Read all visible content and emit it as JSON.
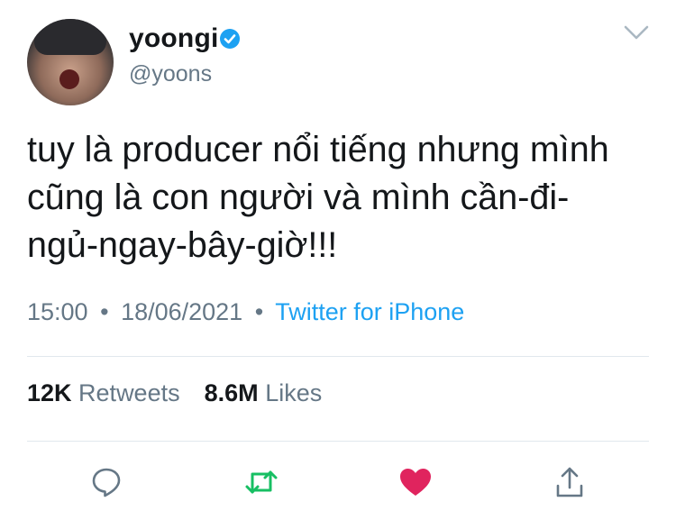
{
  "user": {
    "name": "yoongi",
    "handle": "@yoons"
  },
  "tweet": {
    "text_line1": "tuy là producer nổi tiếng nhưng mình",
    "text_line2": "cũng là con người và mình cần-đi-",
    "text_line3": "ngủ-ngay-bây-giờ!!!",
    "time": "15:00",
    "date": "18/06/2021",
    "source": "Twitter for iPhone",
    "separator": "•"
  },
  "stats": {
    "retweets_count": "12K",
    "retweets_label": "Retweets",
    "likes_count": "8.6M",
    "likes_label": "Likes"
  },
  "icons": {
    "reply": "reply-icon",
    "retweet": "retweet-icon",
    "like": "heart-icon",
    "share": "share-icon",
    "verified": "verified-badge-icon",
    "menu": "chevron-down-icon"
  },
  "colors": {
    "blue": "#1da1f2",
    "retweet_green": "#17bf63",
    "like_red": "#e0245e",
    "muted": "#657786"
  }
}
